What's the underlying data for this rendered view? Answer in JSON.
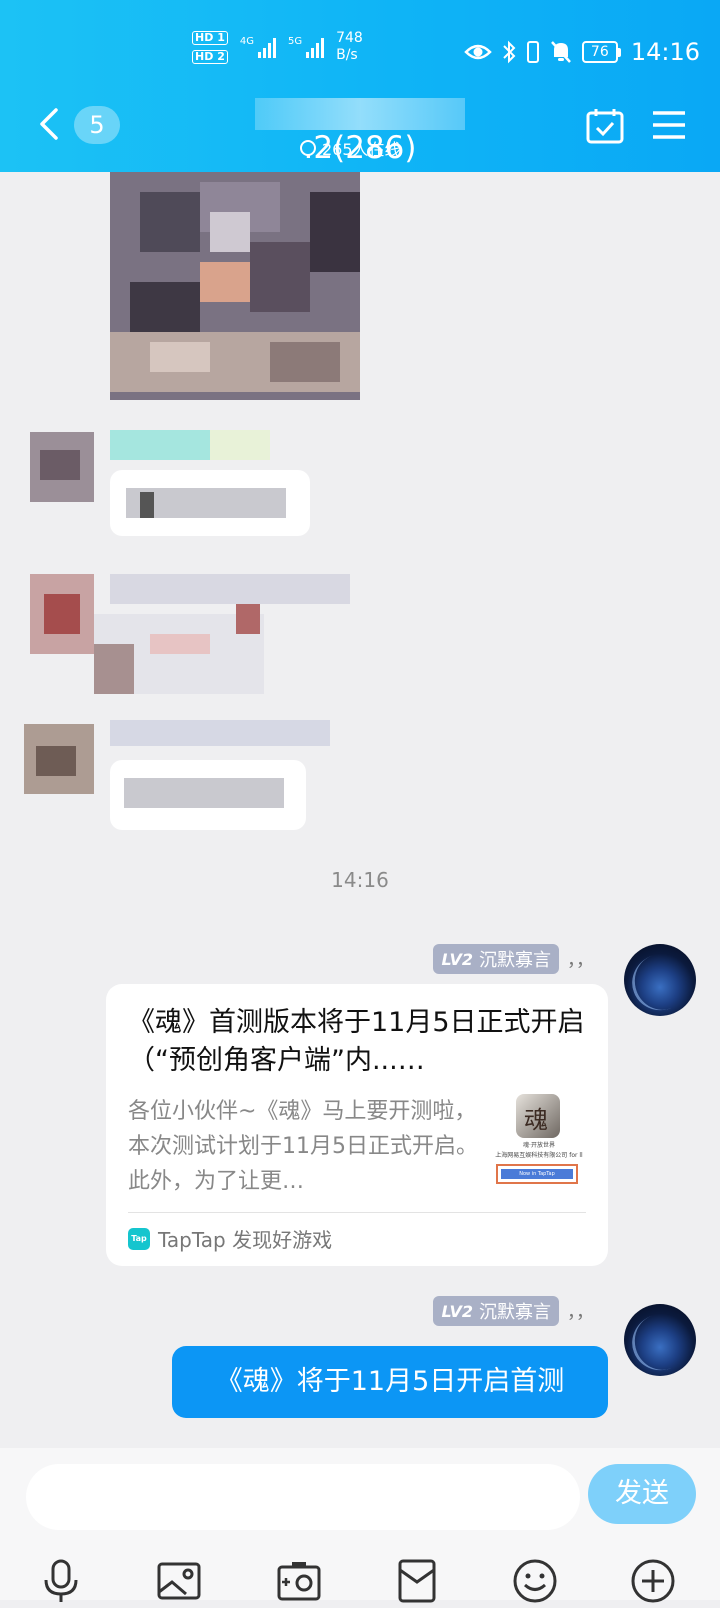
{
  "status_bar": {
    "hd1": "HD",
    "hd1_num": "1",
    "hd2": "HD",
    "hd2_num": "2",
    "net1": "4G",
    "net2": "5G",
    "speed_value": "748",
    "speed_unit": "B/s",
    "battery": "76",
    "time": "14:16"
  },
  "header": {
    "unread_count": "5",
    "title_visible": ".2(286)",
    "online_count": "265人在线"
  },
  "chat": {
    "timestamp": "14:16",
    "messages": [
      {
        "level": "LV2",
        "sender": "沉默寡言",
        "suffix": "，，",
        "card": {
          "title": "《魂》首测版本将于11月5日正式开启（“预创角客户端”内...…",
          "description": "各位小伙伴~《魂》马上要开测啦，本次测试计划于11月5日正式开启。此外，为了让更…",
          "thumb_line1": "魂·开放世界",
          "thumb_line2": "上海网易互娱科技有限公司 for ll",
          "thumb_button": "Now in TapTap",
          "source_icon": "Tap",
          "source": "TapTap 发现好游戏"
        }
      },
      {
        "level": "LV2",
        "sender": "沉默寡言",
        "suffix": "，，",
        "text": "《魂》将于11月5日开启首测"
      }
    ]
  },
  "input_bar": {
    "placeholder": "",
    "send_label": "发送"
  },
  "colors": {
    "header_blue": "#10b6f6",
    "bubble_blue": "#0c96f5",
    "send_button": "#7ed0fa",
    "level_badge": "#a9b0c6"
  },
  "icons": {
    "back": "chevron-left-icon",
    "calendar": "calendar-check-icon",
    "menu": "hamburger-menu-icon",
    "tools": [
      "microphone-icon",
      "image-icon",
      "camera-icon",
      "red-packet-icon",
      "emoji-icon",
      "plus-icon"
    ]
  }
}
